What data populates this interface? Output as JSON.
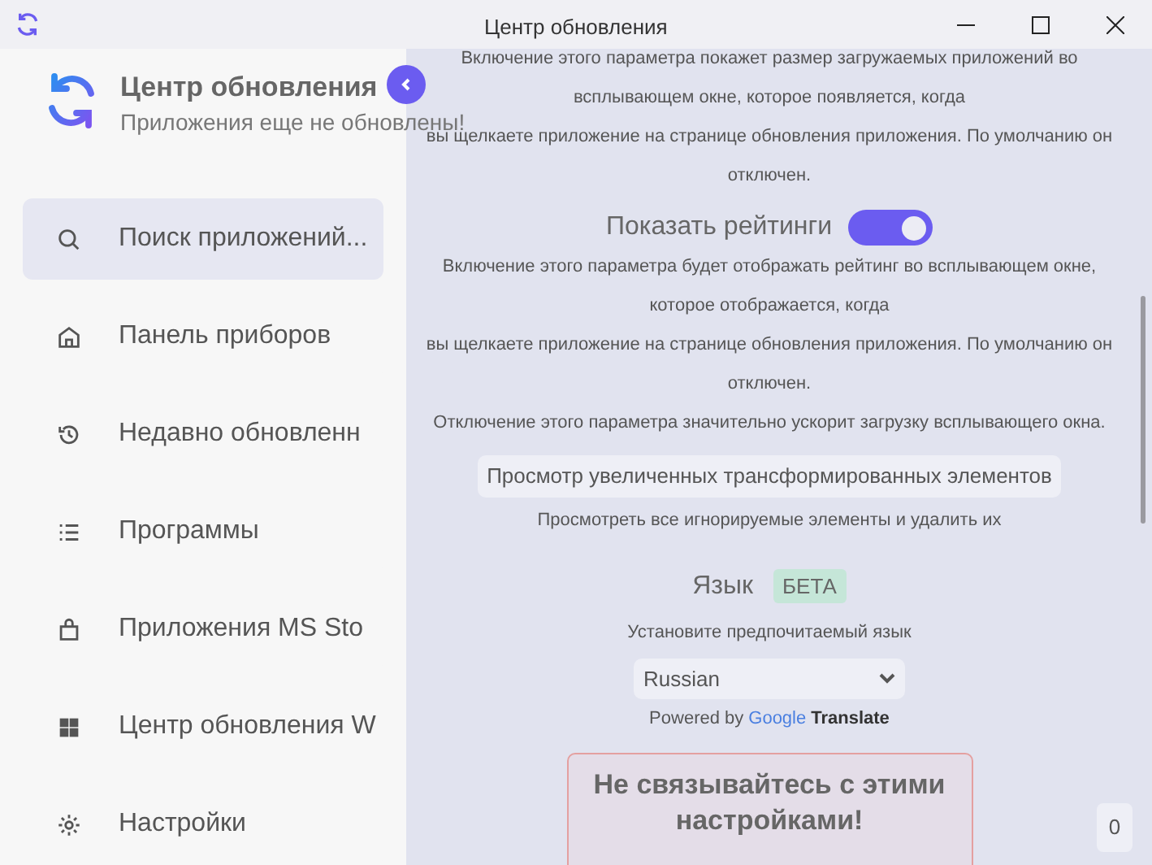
{
  "window": {
    "title": "Центр обновления"
  },
  "sidebar": {
    "title": "Центр обновления",
    "subtitle": "Приложения еще не обновлены!",
    "items": [
      {
        "kind": "search",
        "label": "Поиск приложений...",
        "selected": true
      },
      {
        "kind": "home",
        "label": "Панель приборов",
        "selected": false
      },
      {
        "kind": "history",
        "label": "Недавно обновленн",
        "selected": false
      },
      {
        "kind": "list",
        "label": "Программы",
        "selected": false
      },
      {
        "kind": "bag",
        "label": "Приложения MS Sto",
        "selected": false
      },
      {
        "kind": "windows",
        "label": "Центр обновления W",
        "selected": false
      },
      {
        "kind": "gear",
        "label": "Настройки",
        "selected": false
      }
    ]
  },
  "settings": {
    "top_description": [
      "Включение этого параметра покажет размер загружаемых приложений во",
      "всплывающем окне, которое появляется, когда",
      "вы щелкаете приложение на странице обновления приложения. По умолчанию он",
      "отключен."
    ],
    "ratings": {
      "label": "Показать рейтинги",
      "on": true,
      "description": [
        "Включение этого параметра будет отображать рейтинг во всплывающем окне,",
        "которое отображается, когда",
        "вы щелкаете приложение на странице обновления приложения. По умолчанию он",
        "отключен.",
        "Отключение этого параметра значительно ускорит загрузку всплывающего окна."
      ]
    },
    "ignored": {
      "button": "Просмотр увеличенных трансформированных элементов",
      "description": "Просмотреть все игнорируемые элементы и удалить их"
    },
    "language": {
      "label": "Язык",
      "badge": "БЕТА",
      "description": "Установите предпочитаемый язык",
      "value": "Russian",
      "powered_by": "Powered by",
      "google": "Google",
      "translate": "Translate"
    },
    "warning": {
      "title": "Не связывайтесь с этими настройками!"
    },
    "side_button": "0"
  }
}
